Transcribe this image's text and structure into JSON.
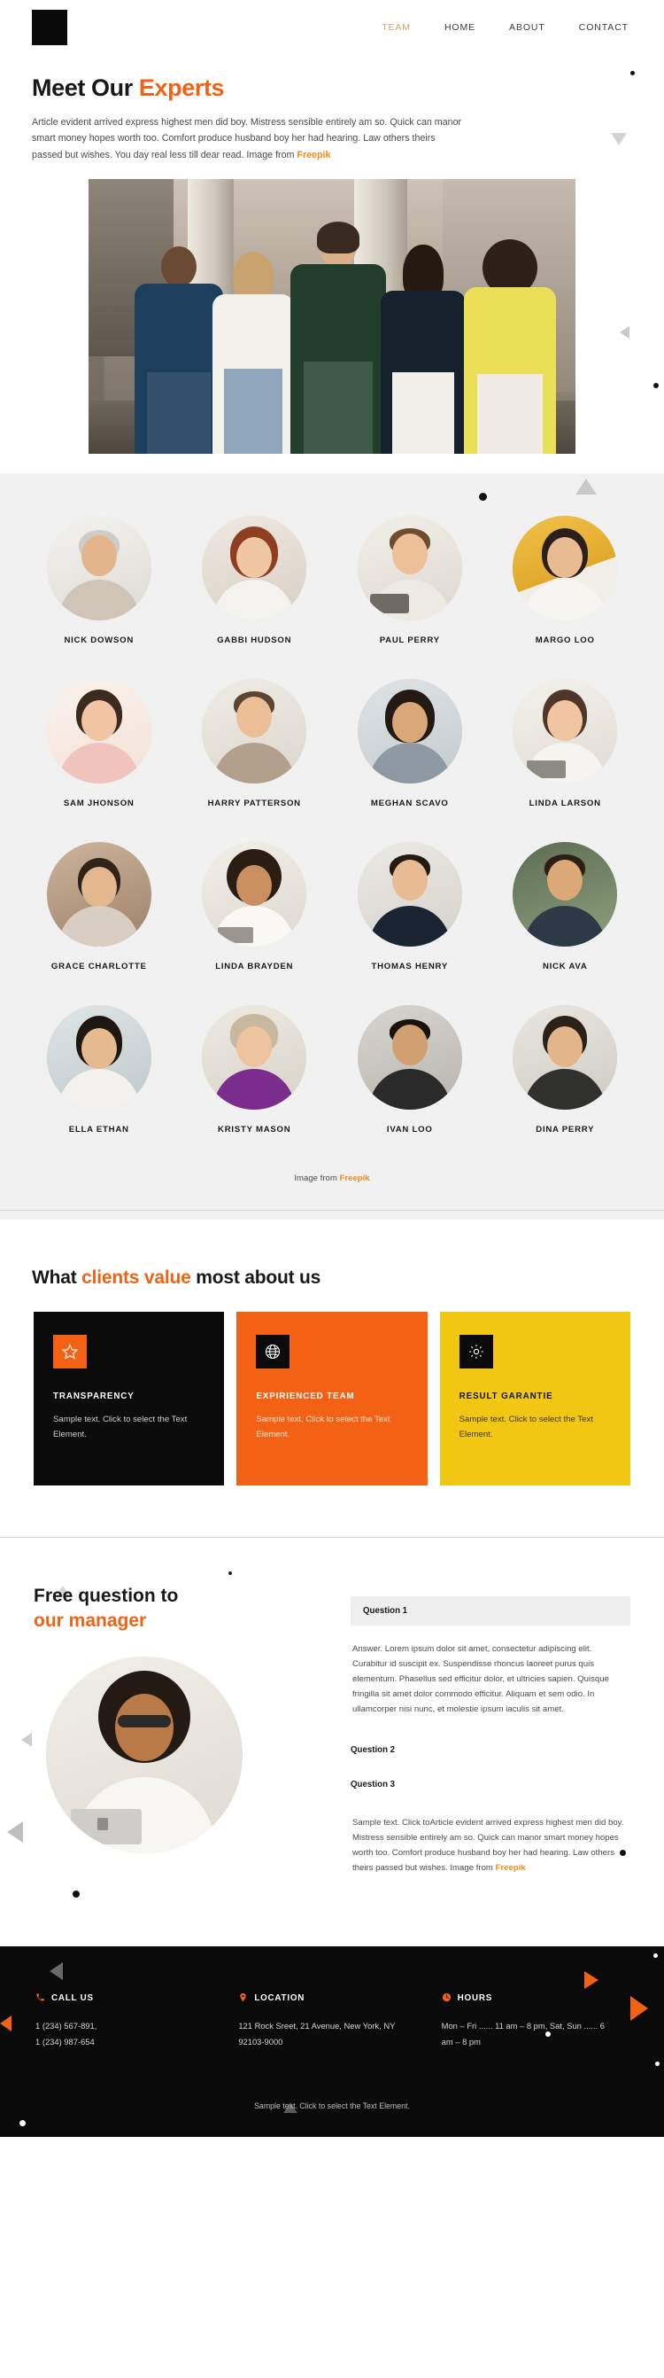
{
  "header": {
    "logo": "logo-mark",
    "nav": [
      {
        "label": "TEAM",
        "active": true
      },
      {
        "label": "HOME",
        "active": false
      },
      {
        "label": "ABOUT",
        "active": false
      },
      {
        "label": "CONTACT",
        "active": false
      }
    ]
  },
  "intro": {
    "title_plain": "Meet Our ",
    "title_accent": "Experts",
    "paragraph": "Article evident arrived express highest men did boy. Mistress sensible entirely am so. Quick can manor smart money hopes worth too. Comfort produce husband boy her had hearing. Law others theirs passed but wishes. You day real less till dear read. Image from ",
    "credit_link": "Freepik"
  },
  "team": {
    "members": [
      {
        "name": "NICK DOWSON"
      },
      {
        "name": "GABBI HUDSON"
      },
      {
        "name": "PAUL PERRY"
      },
      {
        "name": "MARGO LOO"
      },
      {
        "name": "SAM JHONSON"
      },
      {
        "name": "HARRY PATTERSON"
      },
      {
        "name": "MEGHAN SCAVO"
      },
      {
        "name": "LINDA LARSON"
      },
      {
        "name": "GRACE CHARLOTTE"
      },
      {
        "name": "LINDA BRAYDEN"
      },
      {
        "name": "THOMAS HENRY"
      },
      {
        "name": "NICK AVA"
      },
      {
        "name": "ELLA ETHAN"
      },
      {
        "name": "KRISTY MASON"
      },
      {
        "name": "IVAN LOO"
      },
      {
        "name": "DINA PERRY"
      }
    ],
    "credit_prefix": "Image from ",
    "credit_link": "Freepik"
  },
  "values": {
    "heading_a": "What ",
    "heading_accent": "clients value",
    "heading_b": " most about us",
    "cards": [
      {
        "icon": "star-icon",
        "glyph": "☆",
        "title": "TRANSPARENCY",
        "text": "Sample text. Click to select the Text Element.",
        "bg": "#0b0b0b",
        "icon_bg": "#f26114"
      },
      {
        "icon": "globe-icon",
        "glyph": "ἱ0",
        "title": "EXPIRIENCED TEAM",
        "text": "Sample text. Click to select the Text Element.",
        "bg": "#f26114",
        "icon_bg": "#0b0b0b"
      },
      {
        "icon": "gear-icon",
        "glyph": "⚙",
        "title": "RESULT GARANTIE",
        "text": "Sample text. Click to select the Text Element.",
        "bg": "#f2c713",
        "icon_bg": "#0b0b0b"
      }
    ]
  },
  "faq": {
    "title_plain": "Free question to",
    "title_accent": "our manager",
    "questions": [
      {
        "label": "Question 1"
      },
      {
        "label": "Question 2"
      },
      {
        "label": "Question 3"
      }
    ],
    "answer_1": "Answer. Lorem ipsum dolor sit amet, consectetur adipiscing elit. Curabitur id suscipit ex. Suspendisse rhoncus laoreet purus quis elementum. Phasellus sed efficitur dolor, et ultricies sapien. Quisque fringilla sit amet dolor commodo efficitur. Aliquam et sem odio. In ullamcorper nisi nunc, et molestie ipsum iaculis sit amet.",
    "answer_3": "Sample text. Click toArticle evident arrived express highest men did boy. Mistress sensible entirely am so. Quick can manor smart money hopes worth too. Comfort produce husband boy her had hearing. Law others theirs passed but wishes. Image from ",
    "answer_3_link": "Freepik"
  },
  "footer": {
    "columns": [
      {
        "icon": "phone-icon",
        "glyph": "☎",
        "label": "CALL US",
        "text": "1 (234) 567-891,\n1 (234) 987-654"
      },
      {
        "icon": "map-pin-icon",
        "glyph": "◉",
        "label": "LOCATION",
        "text": "121 Rock Sreet, 21 Avenue, New York, NY 92103-9000"
      },
      {
        "icon": "clock-icon",
        "glyph": "◔",
        "label": "HOURS",
        "text": "Mon – Fri ...... 11 am – 8 pm, Sat, Sun  ...... 6 am – 8 pm"
      }
    ],
    "bottom_text": "Sample text. Click to select the Text Element."
  },
  "colors": {
    "accent_orange": "#ef6316",
    "card_orange": "#f26114",
    "card_yellow": "#f2c713",
    "dark": "#0b0b0b",
    "nav_active": "#d9a066",
    "freepik": "#f2a83c"
  }
}
